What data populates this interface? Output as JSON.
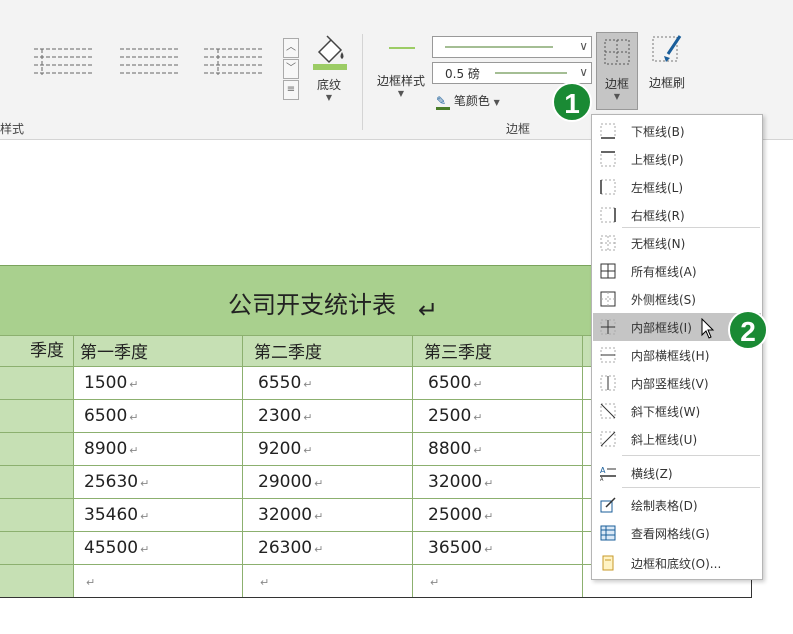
{
  "ribbon": {
    "group_left_label_partial": "样式",
    "shading_label": "底纹",
    "border_style_label": "边框样式",
    "line_weight": "0.5 磅",
    "pen_color_label": "笔颜色",
    "borders_label": "边框",
    "border_painter_label": "边框刷",
    "group_label": "边框",
    "accent_color": "#1a8a34",
    "shading_bar_color": "#9ccc65"
  },
  "callouts": {
    "first": "1",
    "second": "2"
  },
  "table": {
    "title": "公司开支统计表",
    "row_header_partial": "季度",
    "columns": [
      "第一季度",
      "第二季度",
      "第三季度"
    ],
    "rows": [
      [
        "1500",
        "6550",
        "6500"
      ],
      [
        "6500",
        "2300",
        "2500"
      ],
      [
        "8900",
        "9200",
        "8800"
      ],
      [
        "25630",
        "29000",
        "32000"
      ],
      [
        "35460",
        "32000",
        "25000"
      ],
      [
        "45500",
        "26300",
        "36500"
      ],
      [
        "",
        "",
        ""
      ]
    ],
    "paragraph_mark": "↵",
    "title_bg": "#a9d08e",
    "header_bg": "#c6e0b4"
  },
  "menu": {
    "items": [
      {
        "label": "下框线(B)",
        "icon": "bottom-border-icon"
      },
      {
        "label": "上框线(P)",
        "icon": "top-border-icon"
      },
      {
        "label": "左框线(L)",
        "icon": "left-border-icon"
      },
      {
        "label": "右框线(R)",
        "icon": "right-border-icon"
      },
      {
        "label": "无框线(N)",
        "icon": "no-border-icon"
      },
      {
        "label": "所有框线(A)",
        "icon": "all-borders-icon"
      },
      {
        "label": "外侧框线(S)",
        "icon": "outside-borders-icon"
      },
      {
        "label": "内部框线(I)",
        "icon": "inside-borders-icon",
        "highlighted": true
      },
      {
        "label": "内部横框线(H)",
        "icon": "inside-horizontal-border-icon"
      },
      {
        "label": "内部竖框线(V)",
        "icon": "inside-vertical-border-icon"
      },
      {
        "label": "斜下框线(W)",
        "icon": "diagonal-down-border-icon"
      },
      {
        "label": "斜上框线(U)",
        "icon": "diagonal-up-border-icon"
      },
      {
        "label": "横线(Z)",
        "icon": "horizontal-line-icon"
      },
      {
        "label": "绘制表格(D)",
        "icon": "draw-table-icon"
      },
      {
        "label": "查看网格线(G)",
        "icon": "view-gridlines-icon"
      },
      {
        "label": "边框和底纹(O)...",
        "icon": "borders-shading-icon"
      }
    ]
  }
}
